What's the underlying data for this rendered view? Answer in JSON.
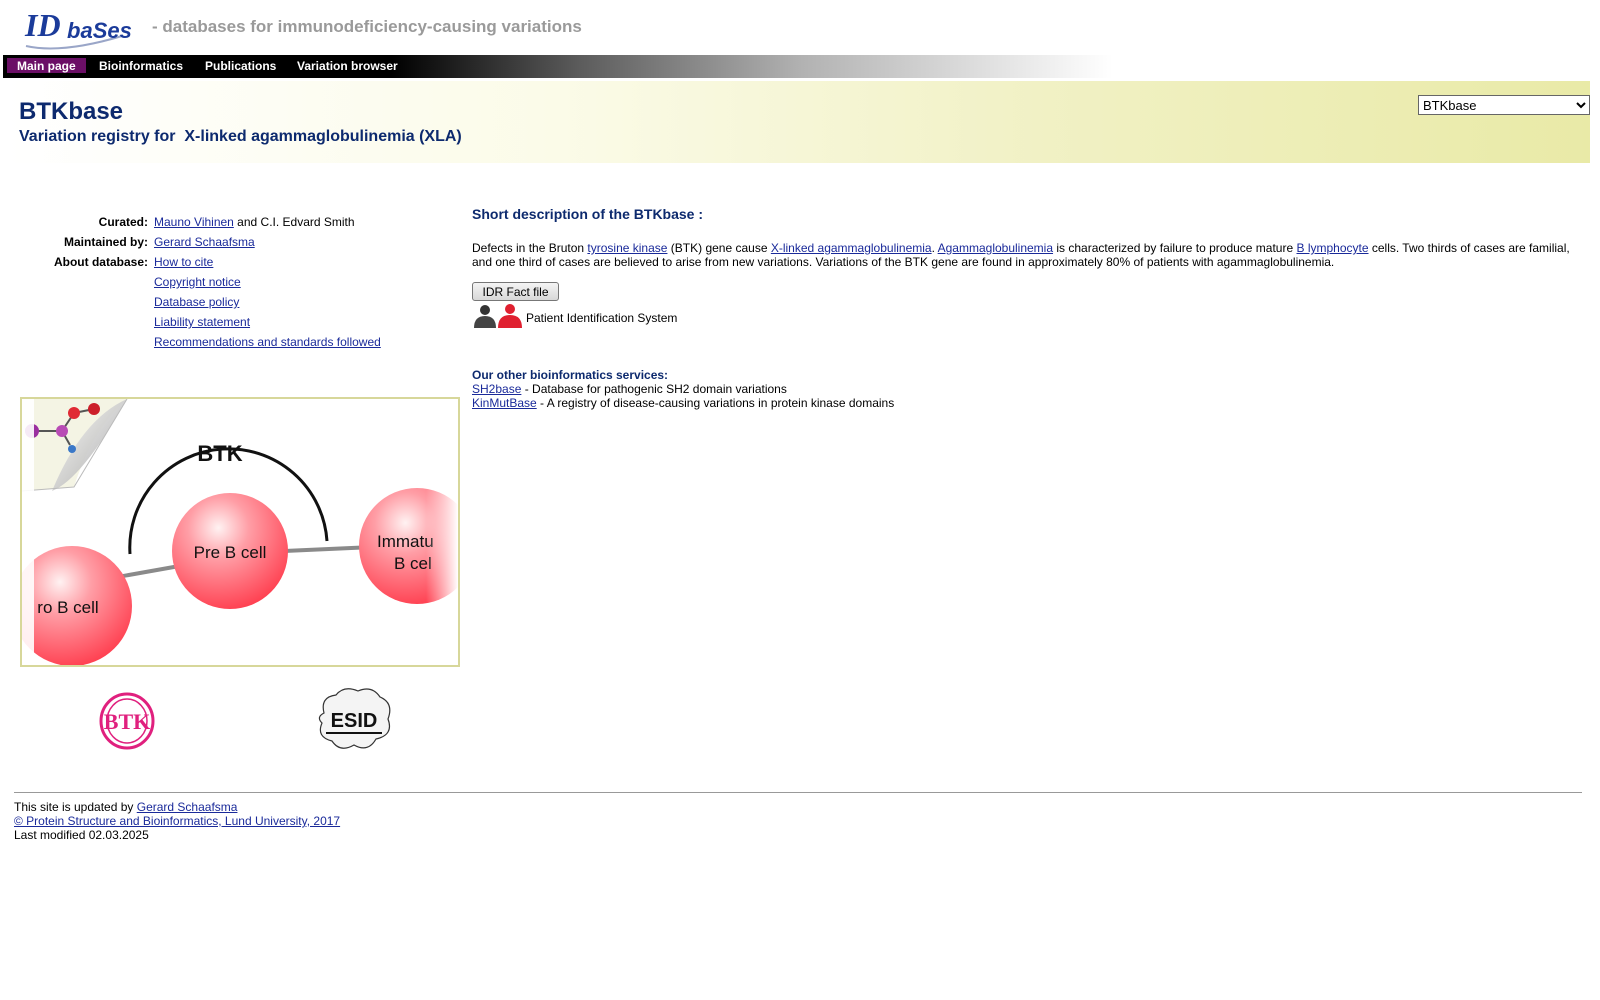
{
  "header": {
    "logo_text": "IDbases",
    "tagline": "- databases for immunodeficiency-causing variations"
  },
  "nav": {
    "items": [
      "Main page",
      "Bioinformatics",
      "Publications",
      "Variation browser"
    ]
  },
  "title": {
    "name": "BTKbase",
    "subtitle": "Variation registry for  X-linked agammaglobulinemia (XLA)",
    "select_value": "BTKbase"
  },
  "info": {
    "curated_label": "Curated:",
    "curated_link": "Mauno Vihinen",
    "curated_rest": " and C.I. Edvard Smith",
    "maintained_label": "Maintained by:",
    "maintained_link": "Gerard Schaafsma",
    "about_label": "About database:",
    "about_links": [
      "How to cite",
      "Copyright notice",
      "Database policy",
      "Liability statement",
      "Recommendations and standards followed"
    ]
  },
  "description": {
    "heading": "Short description of the BTKbase :",
    "t1": "Defects in the Bruton ",
    "l1": "tyrosine kinase",
    "t2": " (BTK) gene cause ",
    "l2": "X-linked agammaglobulinemia",
    "t3": ". ",
    "l3": "Agammaglobulinemia",
    "t4": " is characterized by failure to produce mature ",
    "l4": "B lymphocyte",
    "t5": " cells. Two thirds of cases are familial, and one third of cases are believed to arise from new variations. Variations of the BTK gene are found in approximately 80% of patients with agammaglobulinemia.",
    "button": "IDR Fact file",
    "pis_label": "Patient Identification System"
  },
  "other": {
    "heading": "Our other bioinformatics services:",
    "services": [
      {
        "name": "SH2base",
        "desc": " - Database for pathogenic SH2 domain variations"
      },
      {
        "name": "KinMutBase",
        "desc": " - A registry of disease-causing variations in protein kinase domains"
      }
    ]
  },
  "illustration": {
    "label_btk": "BTK",
    "cell_pre": "Pre B cell",
    "cell_pro": "ro B cell",
    "cell_immature_1": "Immatu",
    "cell_immature_2": "B cel"
  },
  "logos": {
    "btk_text": "BTK",
    "esid_text": "ESID"
  },
  "footer": {
    "updated_text": "This site is updated by ",
    "updated_link": "Gerard Schaafsma",
    "copyright": "© Protein Structure and Bioinformatics, Lund University, 2017",
    "last_modified": "Last modified 02.03.2025"
  },
  "colors": {
    "nav_active": "#6b0f66",
    "title_blue": "#0d2a6e",
    "link_blue": "#1a2a9a",
    "tagline_gray": "#9a9a9a"
  }
}
